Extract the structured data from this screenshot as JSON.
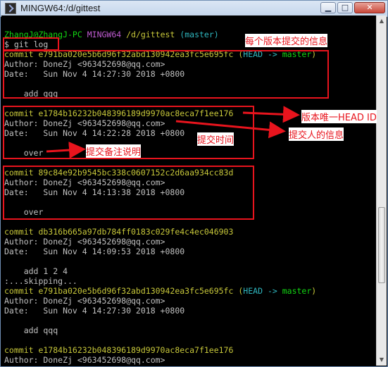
{
  "window": {
    "title": "MINGW64:/d/gittest"
  },
  "prompt": {
    "user_host": "ZhangJ@ZhangJ-PC",
    "shell": "MINGW64",
    "path": "/d/gittest",
    "branch": "(master)",
    "symbol": "$",
    "command": "git log"
  },
  "log": {
    "c1_hash": "commit e791ba020e5b6d96f32abd130942ea3fc5e695fc",
    "c1_ref_open": "(",
    "c1_ref_head": "HEAD",
    "c1_ref_arrow": "->",
    "c1_ref_branch": "master",
    "c1_ref_close": ")",
    "c1_author": "Author: DoneZj <963452698@qq.com>",
    "c1_date": "Date:   Sun Nov 4 14:27:30 2018 +0800",
    "c1_msg": "    add qqq",
    "c2_hash": "commit e1784b16232b048396189d9970ac8eca7f1ee176",
    "c2_author": "Author: DoneZj <963452698@qq.com>",
    "c2_date": "Date:   Sun Nov 4 14:22:28 2018 +0800",
    "c2_msg": "    over",
    "c3_hash": "commit 89c84e92b9545bc338c0607152c2d6aa934cc83d",
    "c3_author": "Author: DoneZj <963452698@qq.com>",
    "c3_date": "Date:   Sun Nov 4 14:13:38 2018 +0800",
    "c3_msg": "    over",
    "c4_hash": "commit db316b665a97db784ff0183c029fe4c4ec046903",
    "c4_author": "Author: DoneZj <963452698@qq.com>",
    "c4_date": "Date:   Sun Nov 4 14:09:53 2018 +0800",
    "c4_msg": "    add 1 2 4",
    "skipping": ":...skipping...",
    "c5_hash": "commit e791ba020e5b6d96f32abd130942ea3fc5e695fc",
    "c5_author": "Author: DoneZj <963452698@qq.com>",
    "c5_date": "Date:   Sun Nov 4 14:27:30 2018 +0800",
    "c5_msg": "    add qqq",
    "c6_hash": "commit e1784b16232b048396189d9970ac8eca7f1ee176",
    "c6_author": "Author: DoneZj <963452698@qq.com>"
  },
  "annotations": {
    "commit_info": "每个版本提交的信息",
    "head_id": "版本唯一HEAD ID",
    "author_info": "提交人的信息",
    "commit_time": "提交时间",
    "commit_note": "提交备注说明"
  },
  "colors": {
    "annotation_red": "#e8141d",
    "prompt_green": "#12d612",
    "commit_yellow": "#c7c73a"
  }
}
